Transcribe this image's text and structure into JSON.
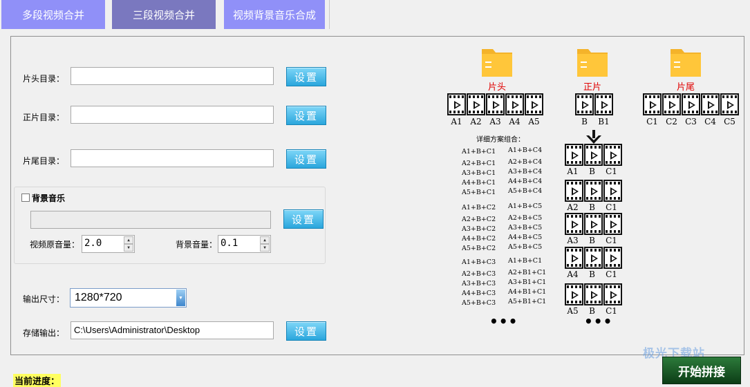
{
  "tabs": [
    "多段视频合并",
    "三段视频合并",
    "视频背景音乐合成"
  ],
  "form": {
    "head_label": "片头目录：",
    "main_label": "正片目录：",
    "tail_label": "片尾目录：",
    "head_value": "",
    "main_value": "",
    "tail_value": "",
    "set_label": "设置",
    "music_label": "背景音乐",
    "music_value": "",
    "orig_volume_label": "视频原音量：",
    "orig_volume_value": "2.0",
    "bg_volume_label": "背景音量：",
    "bg_volume_value": "0.1",
    "size_label": "输出尺寸：",
    "size_value": "1280*720",
    "save_label": "存储输出：",
    "save_value": "C:\\Users\\Administrator\\Desktop"
  },
  "diagram": {
    "folders": [
      "片头",
      "正片",
      "片尾"
    ],
    "head_clips": [
      "A1",
      "A2",
      "A3",
      "A4",
      "A5"
    ],
    "main_clips": [
      "B",
      "B1"
    ],
    "tail_clips": [
      "C1",
      "C2",
      "C3",
      "C4",
      "C5"
    ],
    "detail_title": "详细方案组合：",
    "combos_col1": [
      "A1+B+C1",
      "A2+B+C1",
      "A3+B+C1",
      "A4+B+C1",
      "A5+B+C1",
      "A1+B+C2",
      "A2+B+C2",
      "A3+B+C2",
      "A4+B+C2",
      "A5+B+C2",
      "A1+B+C3",
      "A2+B+C3",
      "A3+B+C3",
      "A4+B+C3",
      "A5+B+C3"
    ],
    "combos_col2": [
      "A1+B+C4",
      "A2+B+C4",
      "A3+B+C4",
      "A4+B+C4",
      "A5+B+C4",
      "A1+B+C5",
      "A2+B+C5",
      "A3+B+C5",
      "A4+B+C5",
      "A5+B+C5",
      "A1+B+C1",
      "A2+B1+C1",
      "A3+B1+C1",
      "A4+B1+C1",
      "A5+B1+C1"
    ],
    "result_rows": [
      [
        "A1",
        "B",
        "C1"
      ],
      [
        "A2",
        "B",
        "C1"
      ],
      [
        "A3",
        "B",
        "C1"
      ],
      [
        "A4",
        "B",
        "C1"
      ],
      [
        "A5",
        "B",
        "C1"
      ]
    ],
    "ellipsis": "•••"
  },
  "progress_label": "当前进度：",
  "start_label": "开始拼接",
  "watermark": "极光下载站",
  "colors": {
    "tab_active": "#7a78bf",
    "tab_inactive": "#9090f8",
    "button": "#2aa6dc",
    "caption_red": "#e00000"
  }
}
